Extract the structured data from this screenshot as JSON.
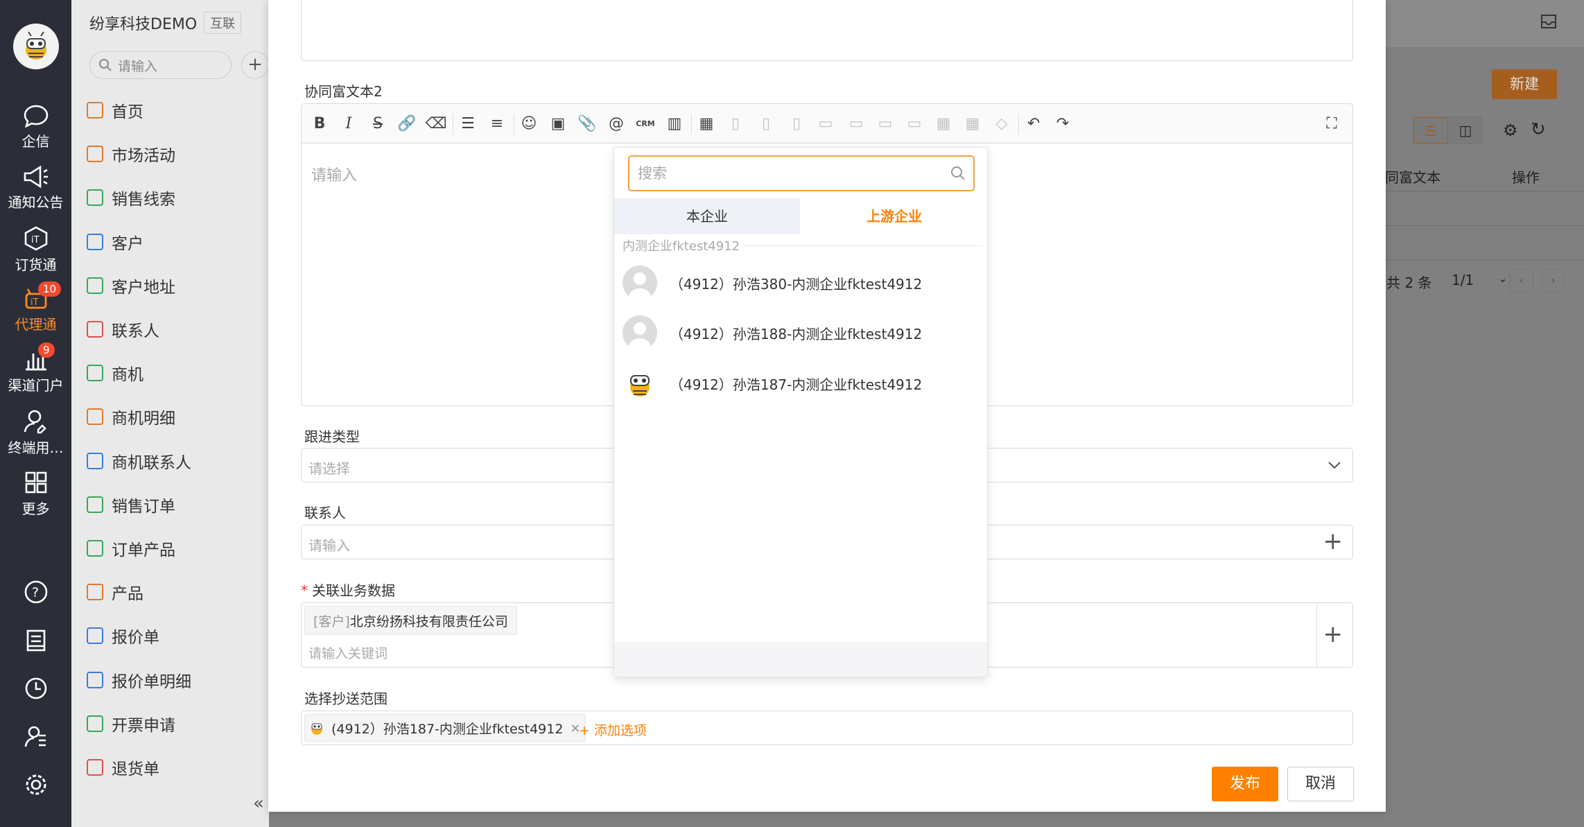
{
  "company": {
    "name": "纷享科技DEMO",
    "tag": "互联"
  },
  "menu_search": {
    "placeholder": "请输入"
  },
  "rail": [
    {
      "label": "企信",
      "icon": "chat-icon"
    },
    {
      "label": "通知公告",
      "icon": "megaphone-icon"
    },
    {
      "label": "订货通",
      "icon": "order-icon"
    },
    {
      "label": "代理通",
      "icon": "agent-icon",
      "badge": "10",
      "active": true
    },
    {
      "label": "渠道门户",
      "icon": "chart-icon",
      "badge": "9"
    },
    {
      "label": "终端用…",
      "icon": "user-icon"
    },
    {
      "label": "更多",
      "icon": "grid-icon"
    }
  ],
  "menu_items": [
    "首页",
    "市场活动",
    "销售线索",
    "客户",
    "客户地址",
    "联系人",
    "商机",
    "商机明细",
    "商机联系人",
    "销售订单",
    "订单产品",
    "产品",
    "报价单",
    "报价单明细",
    "开票申请",
    "退货单"
  ],
  "background": {
    "new_button": "新建",
    "col_rich_text": "同富文本",
    "col_ops": "操作",
    "pagination_total": "共 2 条",
    "pagination_page": "1/1"
  },
  "form": {
    "rich_label": "协同富文本2",
    "rich_placeholder": "请输入",
    "follow_type_label": "跟进类型",
    "follow_type_placeholder": "请选择",
    "contact_label": "联系人",
    "contact_placeholder": "请输入",
    "related_label": "关联业务数据",
    "related_chip_prefix": "[客户]",
    "related_chip_value": "北京纷扬科技有限责任公司",
    "related_placeholder": "请输入关键词",
    "cc_label": "选择抄送范围",
    "cc_chip": "(4912）孙浩187-内测企业fktest4912",
    "cc_add": "+ 添加选项",
    "publish": "发布",
    "cancel": "取消"
  },
  "popup": {
    "search_placeholder": "搜索",
    "tabs": [
      "本企业",
      "上游企业"
    ],
    "group": "内测企业fktest4912",
    "people": [
      "（4912）孙浩380-内测企业fktest4912",
      "（4912）孙浩188-内测企业fktest4912",
      "（4912）孙浩187-内测企业fktest4912"
    ]
  },
  "colors": {
    "accent": "#ff8000",
    "rail_bg": "#2b2e38",
    "badge": "#f04a30"
  }
}
